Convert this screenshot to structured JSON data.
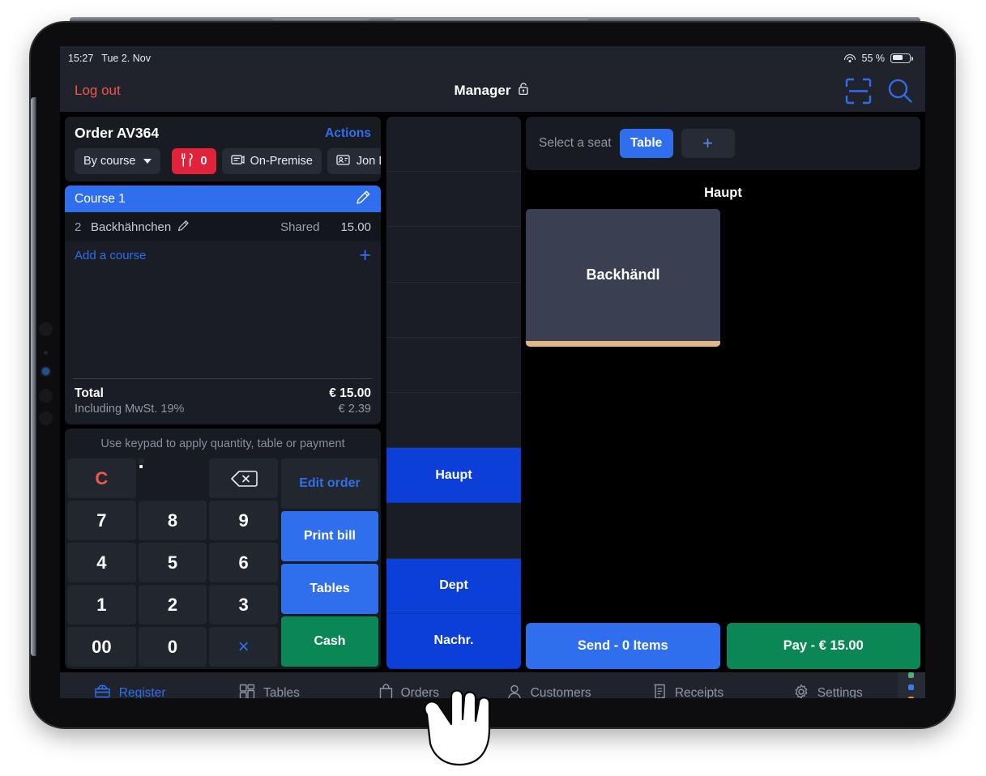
{
  "status_bar": {
    "time": "15:27",
    "date": "Tue 2. Nov",
    "battery_percent": "55 %",
    "wifi_icon": "wifi-icon",
    "battery_icon": "battery-icon"
  },
  "app_bar": {
    "logout": "Log out",
    "title": "Manager",
    "lock_icon": "unlocked-padlock-icon",
    "scan_icon": "barcode-scanner-icon",
    "search_icon": "search-icon"
  },
  "order": {
    "id": "Order AV364",
    "actions": "Actions",
    "chips": [
      {
        "label": "By course",
        "icon": "chevron-down-icon",
        "type": "select"
      },
      {
        "label": "0",
        "icon": "cutlery-icon",
        "type": "badge-red"
      },
      {
        "label": "On-Premise",
        "icon": "receipt-icon",
        "type": "chip"
      },
      {
        "label": "Jon D",
        "icon": "id-badge-icon",
        "type": "chip"
      }
    ],
    "course": {
      "label": "Course 1",
      "edit_icon": "pencil-icon"
    },
    "item": {
      "qty": "2",
      "name": "Backhähnchen",
      "edit_icon": "pencil-icon",
      "seat": "Shared",
      "price": "15.00"
    },
    "add_course": {
      "label": "Add a course",
      "icon": "plus-icon"
    },
    "totals": {
      "total_label": "Total",
      "total_value": "€ 15.00",
      "tax_label": "Including MwSt. 19%",
      "tax_value": "€ 2.39"
    }
  },
  "keypad": {
    "hint": "Use keypad to apply quantity, table or payment",
    "keys": [
      "C",
      ".",
      "backspace-icon",
      "7",
      "8",
      "9",
      "4",
      "5",
      "6",
      "1",
      "2",
      "3",
      "00",
      "0",
      "×"
    ],
    "side_buttons": [
      {
        "label": "Edit order",
        "style": "ghost"
      },
      {
        "label": "Print bill",
        "style": "blue"
      },
      {
        "label": "Tables",
        "style": "blue"
      },
      {
        "label": "Cash",
        "style": "green"
      }
    ]
  },
  "mid_column": {
    "cells": [
      {
        "label": "",
        "active": false
      },
      {
        "label": "",
        "active": false
      },
      {
        "label": "",
        "active": false
      },
      {
        "label": "",
        "active": false
      },
      {
        "label": "",
        "active": false
      },
      {
        "label": "",
        "active": false
      },
      {
        "label": "Haupt",
        "active": true
      },
      {
        "label": "",
        "active": false
      },
      {
        "label": "Dept",
        "active": true
      },
      {
        "label": "Nachr.",
        "active": true
      }
    ]
  },
  "right_panel": {
    "seat_label": "Select a seat",
    "seat_button": "Table",
    "add_seat_icon": "plus-icon",
    "category_title": "Haupt",
    "products": [
      {
        "name": "Backhändl",
        "accent": "#e3b78a"
      }
    ],
    "actions": [
      {
        "label": "Send - 0 Items",
        "style": "blue"
      },
      {
        "label": "Pay - € 15.00",
        "style": "green"
      }
    ]
  },
  "tab_bar": {
    "tabs": [
      {
        "label": "Register",
        "icon": "cash-register-icon",
        "active": true
      },
      {
        "label": "Tables",
        "icon": "grid-icon",
        "active": false
      },
      {
        "label": "Orders",
        "icon": "bag-icon",
        "active": false
      },
      {
        "label": "Customers",
        "icon": "person-icon",
        "active": false
      },
      {
        "label": "Receipts",
        "icon": "receipt-list-icon",
        "active": false
      },
      {
        "label": "Settings",
        "icon": "gear-icon",
        "active": false
      }
    ],
    "status_dots": [
      "#4caf7d",
      "#3b7bed",
      "#e8894a",
      "#4caf7d"
    ]
  },
  "colors": {
    "accent_blue": "#2f6fed",
    "accent_green": "#0a8754",
    "accent_red": "#e0233a",
    "panel": "#181b22",
    "screen_bg": "#000000"
  }
}
